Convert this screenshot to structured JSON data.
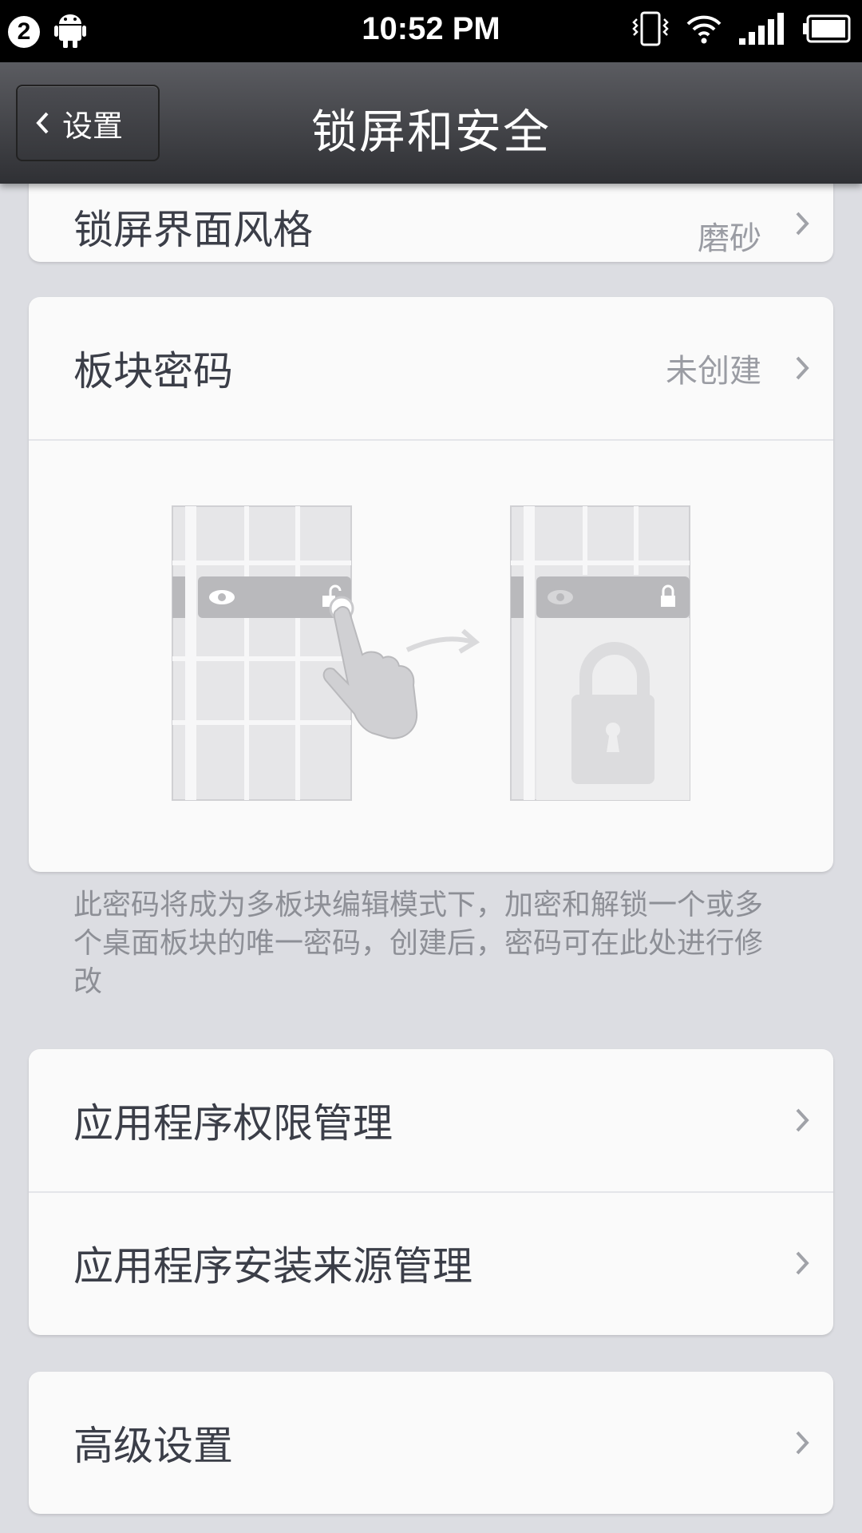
{
  "status_bar": {
    "notification_count": "2",
    "time": "10:52 PM"
  },
  "header": {
    "back_label": "设置",
    "title": "锁屏和安全"
  },
  "lockscreen_style": {
    "label": "锁屏界面风格",
    "value": "磨砂"
  },
  "tile_password": {
    "label": "板块密码",
    "value": "未创建",
    "description": "此密码将成为多板块编辑模式下，加密和解锁一个或多个桌面板块的唯一密码，创建后，密码可在此处进行修改"
  },
  "app_settings": {
    "permission_label": "应用程序权限管理",
    "install_source_label": "应用程序安装来源管理"
  },
  "advanced": {
    "label": "高级设置"
  },
  "icons": [
    "android-icon",
    "vibrate-icon",
    "wifi-icon",
    "signal-icon",
    "battery-icon",
    "chevron-left-icon",
    "chevron-right-icon",
    "eye-icon",
    "unlock-icon",
    "lock-icon",
    "finger-icon",
    "arrow-icon"
  ]
}
